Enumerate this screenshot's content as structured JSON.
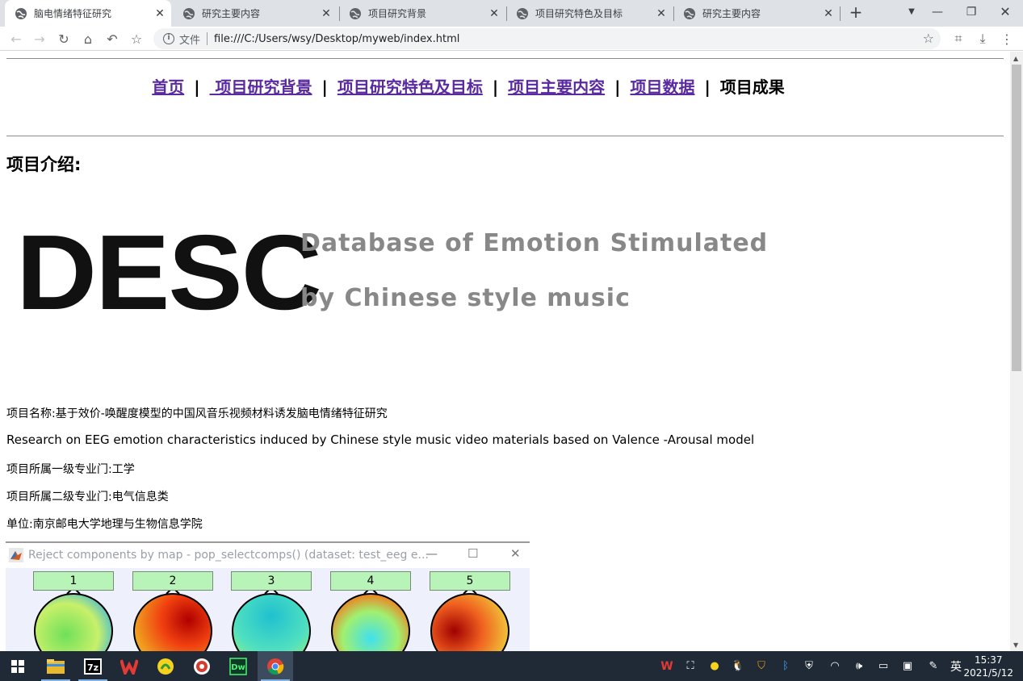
{
  "browser": {
    "tabs": [
      {
        "title": "脑电情绪特征研究",
        "active": true
      },
      {
        "title": "研究主要内容",
        "active": false
      },
      {
        "title": "项目研究背景",
        "active": false
      },
      {
        "title": "项目研究特色及目标",
        "active": false
      },
      {
        "title": "研究主要内容",
        "active": false
      }
    ],
    "address": {
      "protocol_label": "文件",
      "url": "file:///C:/Users/wsy/Desktop/myweb/index.html"
    }
  },
  "page": {
    "nav": {
      "items": [
        "首页",
        " 项目研究背景",
        "项目研究特色及目标",
        "项目主要内容",
        "项目数据"
      ],
      "separator": "|",
      "current": "项目成果"
    },
    "section_title": "项目介绍:",
    "logo": {
      "big": "DESC",
      "line1": "Database of Emotion Stimulated",
      "line2": "by Chinese style music"
    },
    "info": [
      "项目名称:基于效价-唤醒度模型的中国风音乐视频材料诱发脑电情绪特征研究",
      "Research on EEG emotion characteristics induced by Chinese style music video materials based on Valence -Arousal model",
      "项目所属一级专业门:工学",
      "项目所属二级专业门:电气信息类",
      "单位:南京邮电大学地理与生物信息学院"
    ],
    "matlab": {
      "title": "Reject components by map - pop_selectcomps() (dataset: test_eeg e...",
      "components": [
        "1",
        "2",
        "3",
        "4",
        "5"
      ]
    }
  },
  "taskbar": {
    "ime": "英",
    "time": "15:37",
    "date": "2021/5/12"
  },
  "colors": {
    "link": "#5a2aa0",
    "taskbar": "#1f2a36",
    "tabstrip": "#dee1e6"
  }
}
